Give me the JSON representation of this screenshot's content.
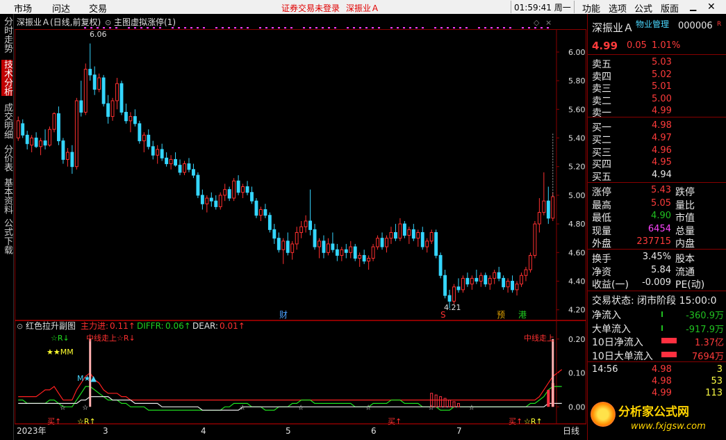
{
  "menubar": {
    "items": [
      "市场",
      "问达",
      "交易"
    ],
    "warning": "证券交易未登录",
    "stock_title": "深振业Ａ",
    "clock": "01:59:41 周一",
    "right_items": [
      "功能",
      "选项",
      "公式",
      "版面"
    ]
  },
  "left_tabs": [
    "分时走势",
    "技术分析",
    "成交明细",
    "分价表",
    "基本资料",
    "公式下载"
  ],
  "chart_header": {
    "title": "深振业Ａ(日线,前复权)",
    "indicator": "主图虚拟涨停(1)"
  },
  "sub_header": {
    "name": "红色拉升副图",
    "main_label": "主力进:",
    "main_value": "0.11↑",
    "diffr_label": "DIFFR:",
    "diffr_value": "0.06↑",
    "dear_label": "DEAR:",
    "dear_value": "0.01↑"
  },
  "annotations": {
    "high_label": "6.06",
    "low_label": "4.21",
    "events": [
      "财",
      "S",
      "预",
      "港"
    ],
    "sub_left": [
      "☆R↓",
      "★★MM",
      "M★▲"
    ],
    "sub_mid1": "中线走上☆R↓",
    "sub_right": "中线走上",
    "buy_marks": [
      "买↑",
      "☆R↑",
      "买↑",
      "买↑",
      "☆R↑"
    ]
  },
  "x_axis": {
    "labels": [
      "2023年",
      "3",
      "4",
      "5",
      "6",
      "7"
    ],
    "period": "日线"
  },
  "chart_data": {
    "type": "candlestick",
    "y_ticks": [
      6.0,
      5.8,
      5.6,
      5.4,
      5.2,
      5.0,
      4.8,
      4.6,
      4.4,
      4.2
    ],
    "ylim": [
      4.15,
      6.15
    ],
    "sub_y_ticks": [
      0.2,
      0.1,
      0.0
    ],
    "sub_ylim": [
      -0.02,
      0.22
    ],
    "ohlc": [
      [
        5.4,
        5.55,
        5.38,
        5.52
      ],
      [
        5.5,
        5.53,
        5.4,
        5.42
      ],
      [
        5.42,
        5.45,
        5.32,
        5.36
      ],
      [
        5.35,
        5.42,
        5.3,
        5.4
      ],
      [
        5.4,
        5.44,
        5.33,
        5.34
      ],
      [
        5.34,
        5.4,
        5.28,
        5.38
      ],
      [
        5.38,
        5.46,
        5.32,
        5.35
      ],
      [
        5.35,
        5.48,
        5.34,
        5.46
      ],
      [
        5.46,
        5.58,
        5.44,
        5.57
      ],
      [
        5.57,
        5.62,
        5.35,
        5.38
      ],
      [
        5.38,
        5.4,
        5.22,
        5.25
      ],
      [
        5.25,
        5.33,
        5.2,
        5.3
      ],
      [
        5.3,
        5.35,
        5.15,
        5.2
      ],
      [
        5.2,
        5.68,
        5.18,
        5.66
      ],
      [
        5.66,
        5.8,
        5.55,
        5.58
      ],
      [
        5.58,
        5.92,
        5.56,
        5.88
      ],
      [
        5.88,
        6.06,
        5.8,
        5.84
      ],
      [
        5.84,
        5.9,
        5.7,
        5.74
      ],
      [
        5.74,
        5.85,
        5.72,
        5.82
      ],
      [
        5.82,
        5.84,
        5.62,
        5.64
      ],
      [
        5.64,
        5.7,
        5.5,
        5.55
      ],
      [
        5.55,
        5.68,
        5.52,
        5.66
      ],
      [
        5.66,
        5.82,
        5.6,
        5.78
      ],
      [
        5.78,
        5.8,
        5.56,
        5.58
      ],
      [
        5.58,
        5.64,
        5.5,
        5.52
      ],
      [
        5.52,
        5.58,
        5.44,
        5.55
      ],
      [
        5.55,
        5.6,
        5.48,
        5.5
      ],
      [
        5.5,
        5.52,
        5.36,
        5.38
      ],
      [
        5.38,
        5.44,
        5.3,
        5.42
      ],
      [
        5.42,
        5.46,
        5.32,
        5.34
      ],
      [
        5.34,
        5.38,
        5.25,
        5.28
      ],
      [
        5.28,
        5.35,
        5.22,
        5.32
      ],
      [
        5.32,
        5.36,
        5.24,
        5.26
      ],
      [
        5.26,
        5.3,
        5.2,
        5.22
      ],
      [
        5.22,
        5.28,
        5.18,
        5.25
      ],
      [
        5.25,
        5.3,
        5.2,
        5.21
      ],
      [
        5.21,
        5.25,
        5.14,
        5.16
      ],
      [
        5.16,
        5.24,
        5.14,
        5.22
      ],
      [
        5.22,
        5.26,
        5.16,
        5.18
      ],
      [
        5.18,
        5.22,
        5.12,
        5.14
      ],
      [
        5.14,
        5.16,
        4.98,
        5.0
      ],
      [
        5.0,
        5.04,
        4.9,
        4.94
      ],
      [
        4.94,
        5.0,
        4.88,
        4.98
      ],
      [
        4.98,
        5.02,
        4.92,
        4.96
      ],
      [
        4.96,
        5.0,
        4.9,
        4.92
      ],
      [
        4.92,
        5.02,
        4.9,
        5.0
      ],
      [
        5.0,
        5.08,
        4.96,
        5.04
      ],
      [
        5.04,
        5.06,
        4.96,
        4.98
      ],
      [
        4.98,
        5.12,
        4.96,
        5.1
      ],
      [
        5.1,
        5.14,
        5.0,
        5.02
      ],
      [
        5.02,
        5.08,
        4.98,
        5.06
      ],
      [
        5.06,
        5.1,
        5.0,
        5.02
      ],
      [
        5.02,
        5.06,
        4.94,
        4.96
      ],
      [
        4.96,
        4.98,
        4.84,
        4.86
      ],
      [
        4.86,
        4.92,
        4.82,
        4.9
      ],
      [
        4.9,
        4.94,
        4.84,
        4.86
      ],
      [
        4.86,
        4.88,
        4.74,
        4.76
      ],
      [
        4.76,
        4.8,
        4.66,
        4.7
      ],
      [
        4.7,
        4.74,
        4.6,
        4.62
      ],
      [
        4.62,
        4.7,
        4.52,
        4.68
      ],
      [
        4.68,
        4.74,
        4.58,
        4.6
      ],
      [
        4.6,
        4.68,
        4.55,
        4.66
      ],
      [
        4.66,
        4.78,
        4.62,
        4.74
      ],
      [
        4.74,
        4.82,
        4.7,
        4.78
      ],
      [
        4.78,
        4.86,
        4.74,
        4.82
      ],
      [
        4.82,
        5.04,
        4.72,
        4.76
      ],
      [
        4.76,
        4.8,
        4.62,
        4.64
      ],
      [
        4.64,
        4.7,
        4.56,
        4.68
      ],
      [
        4.68,
        4.72,
        4.56,
        4.6
      ],
      [
        4.6,
        4.7,
        4.58,
        4.66
      ],
      [
        4.66,
        4.74,
        4.6,
        4.62
      ],
      [
        4.62,
        4.66,
        4.54,
        4.58
      ],
      [
        4.58,
        4.64,
        4.54,
        4.62
      ],
      [
        4.62,
        4.66,
        4.56,
        4.6
      ],
      [
        4.6,
        4.68,
        4.56,
        4.64
      ],
      [
        4.64,
        4.66,
        4.54,
        4.56
      ],
      [
        4.56,
        4.6,
        4.5,
        4.58
      ],
      [
        4.58,
        4.62,
        4.52,
        4.54
      ],
      [
        4.54,
        4.58,
        4.48,
        4.56
      ],
      [
        4.56,
        4.66,
        4.54,
        4.64
      ],
      [
        4.64,
        4.72,
        4.62,
        4.7
      ],
      [
        4.7,
        4.74,
        4.62,
        4.64
      ],
      [
        4.64,
        4.72,
        4.6,
        4.7
      ],
      [
        4.7,
        4.78,
        4.66,
        4.74
      ],
      [
        4.74,
        4.8,
        4.68,
        4.7
      ],
      [
        4.7,
        4.84,
        4.68,
        4.8
      ],
      [
        4.8,
        4.82,
        4.7,
        4.72
      ],
      [
        4.72,
        4.78,
        4.66,
        4.76
      ],
      [
        4.76,
        4.8,
        4.68,
        4.7
      ],
      [
        4.7,
        4.76,
        4.64,
        4.74
      ],
      [
        4.74,
        4.78,
        4.62,
        4.64
      ],
      [
        4.64,
        4.7,
        4.6,
        4.68
      ],
      [
        4.68,
        4.76,
        4.66,
        4.74
      ],
      [
        4.74,
        4.76,
        4.56,
        4.58
      ],
      [
        4.58,
        4.6,
        4.42,
        4.44
      ],
      [
        4.44,
        4.48,
        4.28,
        4.3
      ],
      [
        4.3,
        4.34,
        4.21,
        4.26
      ],
      [
        4.26,
        4.38,
        4.24,
        4.36
      ],
      [
        4.36,
        4.42,
        4.32,
        4.34
      ],
      [
        4.34,
        4.44,
        4.32,
        4.42
      ],
      [
        4.42,
        4.46,
        4.36,
        4.38
      ],
      [
        4.38,
        4.44,
        4.34,
        4.42
      ],
      [
        4.42,
        4.48,
        4.38,
        4.4
      ],
      [
        4.4,
        4.46,
        4.36,
        4.44
      ],
      [
        4.44,
        4.46,
        4.36,
        4.38
      ],
      [
        4.38,
        4.44,
        4.34,
        4.42
      ],
      [
        4.42,
        4.48,
        4.38,
        4.46
      ],
      [
        4.46,
        4.5,
        4.4,
        4.42
      ],
      [
        4.42,
        4.44,
        4.34,
        4.36
      ],
      [
        4.36,
        4.42,
        4.32,
        4.4
      ],
      [
        4.4,
        4.44,
        4.32,
        4.34
      ],
      [
        4.34,
        4.4,
        4.3,
        4.38
      ],
      [
        4.38,
        4.46,
        4.36,
        4.44
      ],
      [
        4.44,
        4.5,
        4.4,
        4.48
      ],
      [
        4.48,
        4.6,
        4.46,
        4.58
      ],
      [
        4.58,
        4.82,
        4.56,
        4.8
      ],
      [
        4.8,
        4.98,
        4.74,
        4.88
      ],
      [
        4.88,
        5.16,
        4.86,
        4.96
      ],
      [
        4.96,
        5.06,
        4.8,
        4.84
      ],
      [
        4.84,
        5.02,
        4.82,
        4.99
      ]
    ],
    "series": [
      {
        "name": "主力进",
        "values": [
          0.03,
          0.03,
          0.03,
          0.03,
          0.03,
          0.04,
          0.05,
          0.05,
          0.06,
          0.04,
          0.02,
          0.02,
          0.02,
          0.05,
          0.07,
          0.09,
          0.1,
          0.08,
          0.07,
          0.05,
          0.04,
          0.04,
          0.04,
          0.03,
          0.03,
          0.02,
          0.02,
          0.02,
          0.02,
          0.02,
          0.02,
          0.02,
          0.02,
          0.02,
          0.02,
          0.02,
          0.02,
          0.02,
          0.02,
          0.02,
          0.02,
          0.02,
          0.02,
          0.02,
          0.02,
          0.02,
          0.02,
          0.02,
          0.02,
          0.02,
          0.02,
          0.02,
          0.02,
          0.02,
          0.02,
          0.02,
          0.02,
          0.02,
          0.02,
          0.02,
          0.02,
          0.02,
          0.02,
          0.02,
          0.02,
          0.02,
          0.02,
          0.02,
          0.02,
          0.02,
          0.02,
          0.02,
          0.02,
          0.02,
          0.02,
          0.02,
          0.02,
          0.02,
          0.02,
          0.02,
          0.02,
          0.02,
          0.02,
          0.02,
          0.02,
          0.02,
          0.02,
          0.02,
          0.02,
          0.02,
          0.02,
          0.02,
          0.02,
          0.02,
          0.02,
          0.02,
          0.02,
          0.02,
          0.02,
          0.02,
          0.02,
          0.02,
          0.02,
          0.02,
          0.02,
          0.02,
          0.02,
          0.02,
          0.02,
          0.02,
          0.02,
          0.02,
          0.02,
          0.02,
          0.02,
          0.02,
          0.03,
          0.05,
          0.07,
          0.09,
          0.1,
          0.11
        ]
      },
      {
        "name": "DIFFR",
        "values": [
          0.02,
          0.02,
          0.01,
          0.01,
          0.01,
          0.01,
          0.01,
          0.02,
          0.02,
          0.01,
          0.0,
          0.0,
          0.0,
          0.02,
          0.04,
          0.06,
          0.06,
          0.05,
          0.04,
          0.03,
          0.02,
          0.02,
          0.02,
          0.01,
          0.01,
          0.0,
          0.0,
          0.0,
          0.0,
          -0.01,
          -0.01,
          -0.01,
          -0.01,
          -0.01,
          -0.01,
          -0.01,
          -0.01,
          -0.01,
          -0.01,
          -0.01,
          -0.01,
          -0.01,
          -0.01,
          -0.01,
          -0.01,
          -0.01,
          0.0,
          0.0,
          0.01,
          0.01,
          0.01,
          0.01,
          0.0,
          0.0,
          0.0,
          -0.01,
          -0.01,
          -0.01,
          0.0,
          0.0,
          0.0,
          0.01,
          0.01,
          0.02,
          0.02,
          0.02,
          0.01,
          0.01,
          0.01,
          0.01,
          0.01,
          0.01,
          0.01,
          0.01,
          0.01,
          0.0,
          0.0,
          0.0,
          0.0,
          0.01,
          0.01,
          0.01,
          0.01,
          0.02,
          0.02,
          0.02,
          0.01,
          0.01,
          0.01,
          0.01,
          0.0,
          0.0,
          0.0,
          0.0,
          -0.01,
          -0.01,
          -0.01,
          0.0,
          0.0,
          0.0,
          0.0,
          0.0,
          0.0,
          0.0,
          0.0,
          0.0,
          0.0,
          0.0,
          0.0,
          0.0,
          0.0,
          0.0,
          0.0,
          0.0,
          0.01,
          0.01,
          0.02,
          0.03,
          0.05,
          0.06,
          0.06,
          0.06
        ]
      },
      {
        "name": "DEAR",
        "values": [
          0.01,
          0.01,
          0.01,
          0.01,
          0.01,
          0.01,
          0.01,
          0.01,
          0.01,
          0.01,
          0.01,
          0.01,
          0.01,
          0.01,
          0.02,
          0.02,
          0.03,
          0.03,
          0.03,
          0.03,
          0.03,
          0.02,
          0.02,
          0.02,
          0.02,
          0.02,
          0.01,
          0.01,
          0.01,
          0.01,
          0.01,
          0.01,
          0.0,
          0.0,
          0.0,
          0.0,
          0.0,
          0.0,
          0.0,
          0.0,
          0.0,
          -0.01,
          -0.01,
          -0.01,
          -0.01,
          -0.01,
          -0.01,
          -0.01,
          -0.01,
          -0.01,
          0.0,
          0.0,
          0.0,
          0.0,
          0.0,
          0.0,
          0.0,
          0.0,
          0.0,
          0.0,
          0.0,
          0.0,
          0.0,
          0.0,
          0.0,
          0.0,
          0.0,
          0.0,
          0.0,
          0.0,
          0.0,
          0.0,
          0.0,
          0.0,
          0.0,
          0.0,
          0.0,
          0.0,
          0.0,
          0.0,
          0.0,
          0.0,
          0.0,
          0.0,
          0.0,
          0.0,
          0.0,
          0.0,
          0.0,
          0.0,
          0.0,
          0.0,
          0.0,
          0.0,
          0.0,
          0.0,
          0.0,
          0.0,
          0.0,
          0.0,
          0.0,
          0.0,
          0.0,
          0.0,
          0.0,
          0.0,
          0.0,
          0.0,
          0.0,
          0.0,
          0.0,
          0.0,
          0.0,
          0.0,
          0.0,
          0.0,
          0.0,
          0.0,
          0.01,
          0.01,
          0.01,
          0.01
        ]
      }
    ]
  },
  "quote": {
    "name": "深振业Ａ",
    "sector": "物业管理",
    "code": "000006",
    "tag": "R",
    "price": "4.99",
    "change": "0.05",
    "change_pct": "1.01%",
    "asks": [
      {
        "label": "卖五",
        "price": "5.03"
      },
      {
        "label": "卖四",
        "price": "5.02"
      },
      {
        "label": "卖三",
        "price": "5.01"
      },
      {
        "label": "卖二",
        "price": "5.00"
      },
      {
        "label": "卖一",
        "price": "4.99"
      }
    ],
    "bids": [
      {
        "label": "买一",
        "price": "4.98"
      },
      {
        "label": "买二",
        "price": "4.97"
      },
      {
        "label": "买三",
        "price": "4.96"
      },
      {
        "label": "买四",
        "price": "4.95"
      },
      {
        "label": "买五",
        "price": "4.94"
      }
    ],
    "stats": [
      {
        "l1": "涨停",
        "v1": "5.43",
        "l2": "跌停"
      },
      {
        "l1": "最高",
        "v1": "5.05",
        "l2": "量比"
      },
      {
        "l1": "最低",
        "v1": "4.90",
        "l2": "市值"
      },
      {
        "l1": "现量",
        "v1": "6454",
        "l2": "总量"
      },
      {
        "l1": "外盘",
        "v1": "237715",
        "l2": "内盘"
      }
    ],
    "stats2": [
      {
        "l1": "换手",
        "v1": "3.45%",
        "l2": "股本"
      },
      {
        "l1": "净资",
        "v1": "5.84",
        "l2": "流通"
      },
      {
        "l1": "收益(一)",
        "v1": "-0.009",
        "l2": "PE(动)"
      }
    ],
    "trade_state": "交易状态: 闭市阶段 15:00:0",
    "flows": [
      {
        "label": "净流入",
        "value": "-360.9万"
      },
      {
        "label": "大单流入",
        "value": "-917.9万"
      },
      {
        "label": "10日净流入",
        "value": "1.37亿"
      },
      {
        "label": "10日大单流入",
        "value": "7694万"
      }
    ],
    "ticks": [
      {
        "time": "14:56",
        "price": "4.98",
        "vol": "3"
      },
      {
        "time": "",
        "price": "4.98",
        "vol": "53"
      },
      {
        "time": "",
        "price": "4.99",
        "vol": "113"
      }
    ],
    "watermark_text": "分析家公式网",
    "watermark_url": "www.fxjgsw.com"
  }
}
